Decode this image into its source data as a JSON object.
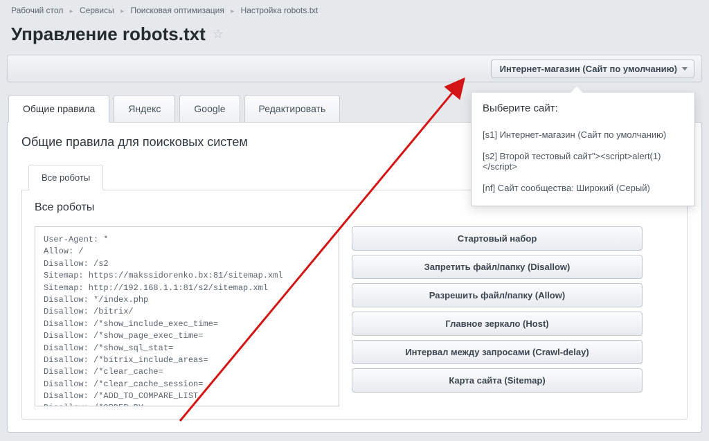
{
  "breadcrumb": [
    "Рабочий стол",
    "Сервисы",
    "Поисковая оптимизация",
    "Настройка robots.txt"
  ],
  "page_title": "Управление robots.txt",
  "site_selector": {
    "label": "Интернет-магазин (Сайт по умолчанию)",
    "heading": "Выберите сайт:",
    "options": [
      "[s1] Интернет-магазин (Сайт по умолчанию)",
      "[s2] Второй тестовый сайт\"><script>alert(1)</script>",
      "[nf] Сайт сообщества: Широкий (Серый)"
    ]
  },
  "top_tabs": [
    "Общие правила",
    "Яндекс",
    "Google",
    "Редактировать"
  ],
  "panel_heading": "Общие правила для поисковых систем",
  "inner_tab": "Все роботы",
  "inner_heading": "Все роботы",
  "code": "User-Agent: *\nAllow: /\nDisallow: /s2\nSitemap: https://makssidorenko.bx:81/sitemap.xml\nSitemap: http://192.168.1.1:81/s2/sitemap.xml\nDisallow: */index.php\nDisallow: /bitrix/\nDisallow: /*show_include_exec_time=\nDisallow: /*show_page_exec_time=\nDisallow: /*show_sql_stat=\nDisallow: /*bitrix_include_areas=\nDisallow: /*clear_cache=\nDisallow: /*clear_cache_session=\nDisallow: /*ADD_TO_COMPARE_LIST\nDisallow: /*ORDER_BY\nDisallow: /*PAGEN",
  "actions": [
    "Стартовый набор",
    "Запретить файл/папку (Disallow)",
    "Разрешить файл/папку (Allow)",
    "Главное зеркало (Host)",
    "Интервал между запросами (Crawl-delay)",
    "Карта сайта (Sitemap)"
  ]
}
